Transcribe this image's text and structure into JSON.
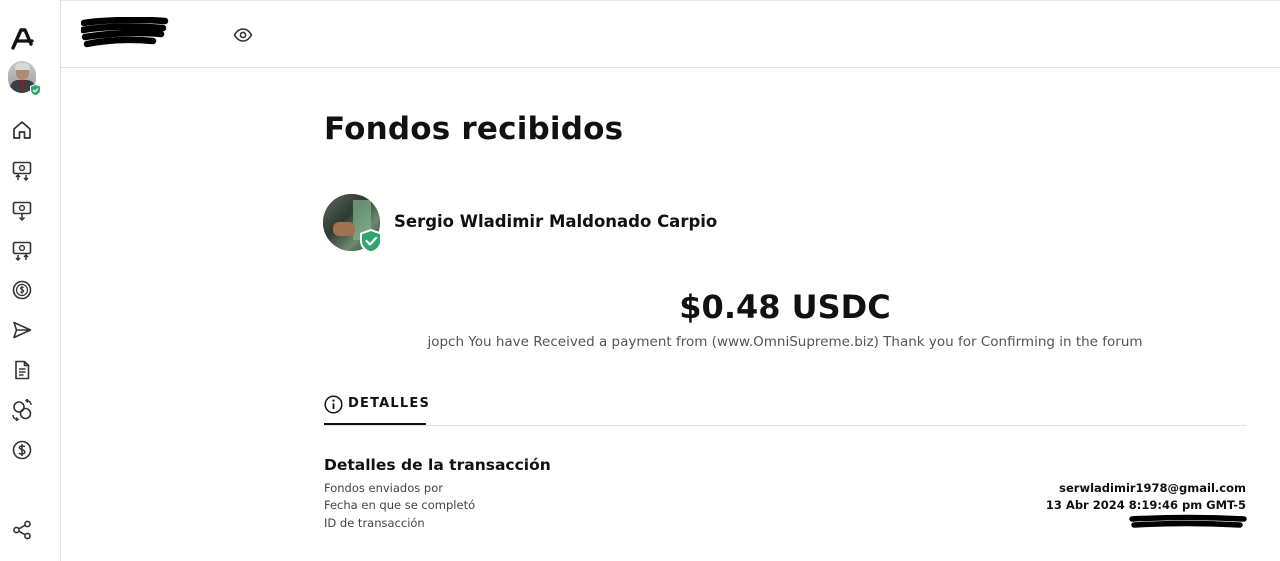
{
  "sidebar": {
    "logo": "app-logo-icon",
    "avatar": "user-avatar",
    "verified_badge": "verified-shield-icon",
    "nav_icons": [
      "home-icon",
      "deposit-icon",
      "withdraw-icon",
      "transfer-icon",
      "coin-icon",
      "send-icon",
      "document-icon",
      "exchange-icon",
      "dollar-icon",
      "share-icon"
    ]
  },
  "header": {
    "redacted_username": "",
    "visibility_icon": "eye-icon"
  },
  "main": {
    "title": "Fondos recibidos",
    "sender": {
      "name": "Sergio Wladimir Maldonado Carpio",
      "verified_badge": "verified-shield-icon"
    },
    "amount": "$0.48 USDC",
    "memo": "jopch You have Received a payment from (www.OmniSupreme.biz) Thank you for Confirming in the forum",
    "tabs": [
      {
        "label": "DETALLES",
        "icon": "info-icon",
        "active": true
      }
    ],
    "details": {
      "title": "Detalles de la transacción",
      "rows": [
        {
          "label": "Fondos enviados por",
          "value": "serwladimir1978@gmail.com"
        },
        {
          "label": "Fecha en que se completó",
          "value": "13 Abr 2024 8:19:46 pm GMT-5"
        },
        {
          "label": "ID de transacción",
          "value": ""
        }
      ]
    }
  },
  "colors": {
    "text": "#111111",
    "muted": "#555555",
    "border": "#e3e3e3",
    "verified_green": "#2fa46b"
  }
}
